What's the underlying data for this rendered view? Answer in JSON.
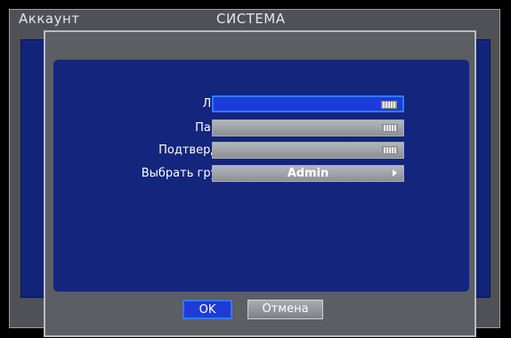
{
  "window": {
    "left_title": "Аккаунт",
    "center_title": "СИСТЕМА"
  },
  "form": {
    "login_label": "Логин",
    "login_value": "",
    "password_label": "Пароль",
    "password_value": "",
    "confirm_label": "Подтвердить",
    "confirm_value": "",
    "group_label": "Выбрать группу",
    "group_value": "Admin"
  },
  "buttons": {
    "ok_label": "OK",
    "cancel_label": "Отмена"
  },
  "icons": {
    "keyboard": "keyboard-icon",
    "arrow": "chevron-right-icon"
  },
  "colors": {
    "panel_blue": "#13257d",
    "active_blue": "#1d3bd8",
    "frame_gray": "#4f5156"
  }
}
